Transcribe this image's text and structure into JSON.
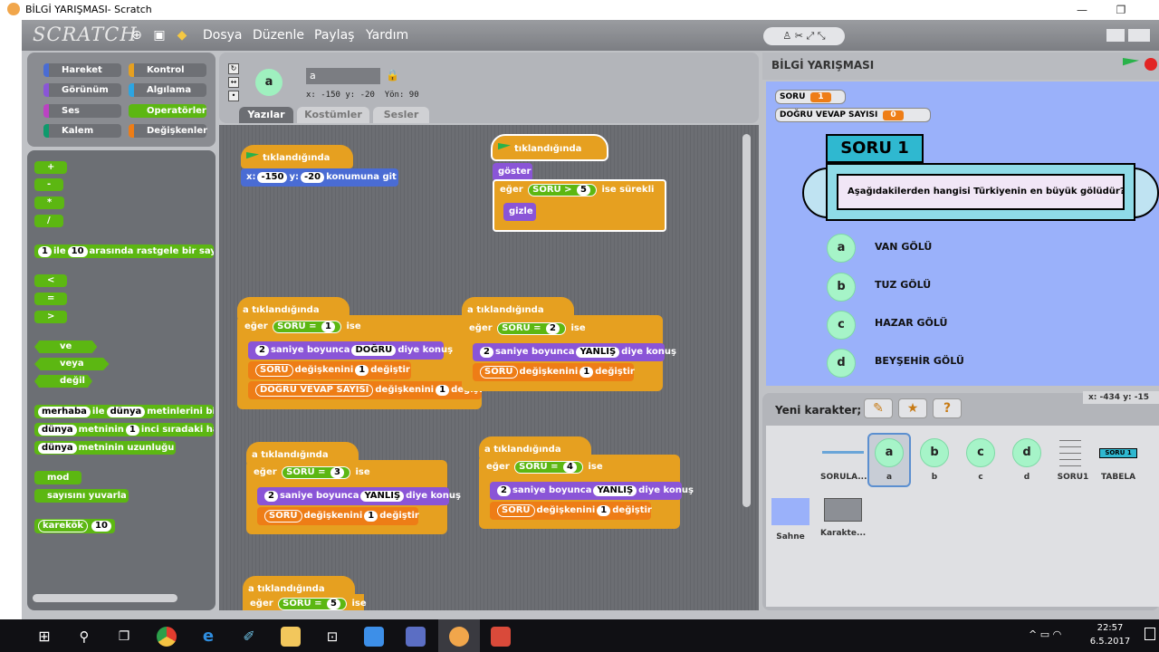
{
  "window": {
    "title": "BİLGİ YARIŞMASI- Scratch",
    "min": "—",
    "max": "❐",
    "close": "✕"
  },
  "menubar": {
    "logo": "SCRATCH",
    "items": [
      "Dosya",
      "Düzenle",
      "Paylaş",
      "Yardım"
    ]
  },
  "categories": [
    {
      "label": "Hareket",
      "color": "#4a6cd4"
    },
    {
      "label": "Kontrol",
      "color": "#e6a020"
    },
    {
      "label": "Görünüm",
      "color": "#8a55d7"
    },
    {
      "label": "Algılama",
      "color": "#2ca5e2"
    },
    {
      "label": "Ses",
      "color": "#bb42c3"
    },
    {
      "label": "Operatörler",
      "color": "#5cb712"
    },
    {
      "label": "Kalem",
      "color": "#0e9a6c"
    },
    {
      "label": "Değişkenler",
      "color": "#ee7d16"
    }
  ],
  "palette": {
    "ops": [
      "+",
      "-",
      "*",
      "/"
    ],
    "random": {
      "pre": "1",
      "mid": "ile",
      "val": "10",
      "post": "arasında rastgele bir sayı s"
    },
    "compares": [
      "<",
      "=",
      ">"
    ],
    "logic": [
      "ve",
      "veya",
      "değil"
    ],
    "join": {
      "a": "merhaba",
      "mid": "ile",
      "b": "dünya",
      "post": "metinlerini birle"
    },
    "letter": {
      "a": "dünya",
      "mid": "metninin",
      "n": "1",
      "post": "inci sıradaki harfi"
    },
    "length": {
      "a": "dünya",
      "post": "metninin uzunluğu"
    },
    "mod": "mod",
    "round": "sayısını yuvarla",
    "sqrt": {
      "fn": "karekök",
      "val": "10"
    }
  },
  "sprite": {
    "name": "a",
    "x": "x: -150",
    "y": "y: -20",
    "dir": "Yön: 90"
  },
  "tabs": [
    "Yazılar",
    "Kostümler",
    "Sesler"
  ],
  "scripts": {
    "flag_hat": "tıklandığında",
    "goto": {
      "x_lbl": "x:",
      "x": "-150",
      "y_lbl": "y:",
      "y": "-20",
      "post": "konumuna git"
    },
    "show": "göster",
    "if": "eğer",
    "forever_if": "ise sürekli",
    "hide": "gizle",
    "soru_var": "SORU",
    "gt": ">",
    "eq": "=",
    "five": "5",
    "click_hat": "a tıklandığında",
    "ise": "ise",
    "say_pre": "saniye boyunca",
    "say_post": "diye konuş",
    "two": "2",
    "dogru": "DOĞRU",
    "yanlis": "YANLIŞ",
    "change": "değişkenini",
    "change_post": "değiştir",
    "one": "1",
    "dogru_var": "DOĞRU VEVAP SAYISI",
    "n1": "1",
    "n2": "2",
    "n3": "3",
    "n4": "4",
    "n5": "5"
  },
  "stage": {
    "title": "BİLGİ YARIŞMASI",
    "mon_soru": "SORU",
    "mon_soru_val": "1",
    "mon_dogru": "DOĞRU VEVAP SAYISI",
    "mon_dogru_val": "0",
    "heading": "SORU 1",
    "question": "Aşağıdakilerden hangisi Türkiyenin en büyük gölüdür?",
    "options": [
      {
        "key": "a",
        "text": "VAN GÖLÜ"
      },
      {
        "key": "b",
        "text": "TUZ GÖLÜ"
      },
      {
        "key": "c",
        "text": "HAZAR GÖLÜ"
      },
      {
        "key": "d",
        "text": "BEYŞEHİR GÖLÜ"
      }
    ]
  },
  "spritepane": {
    "new_label": "Yeni karakter;",
    "coords": "x: -434  y: -15",
    "sprites": [
      "SORULA...",
      "a",
      "b",
      "c",
      "d",
      "SORU1",
      "TABELA"
    ],
    "tabela_text": "SORU 1",
    "stage_label": "Sahne",
    "bg_label": "Karakte..."
  },
  "taskbar": {
    "time": "22:57",
    "date": "6.5.2017"
  }
}
